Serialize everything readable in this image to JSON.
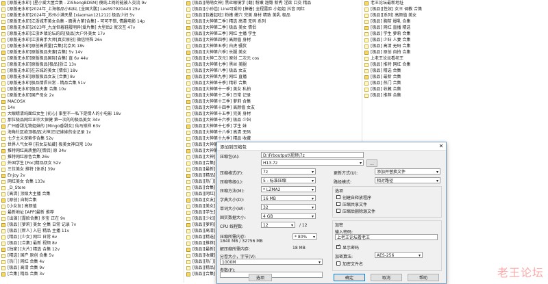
{
  "left_list": [
    "[原版无水印] [星小爱大屋合集 - ZiShengBDSM] 傻纯上网的能被人交流 9v",
    "[原版无水印]2024年_上海极品小纠纠, [全国大鹏] Lee597920443 25v",
    "[原版无水印]2024年_苏州小满天星 [xiaoman121212] 极品少妇 5v",
    "[原版无水印]江浙城市美女合集 - 面勇力第[合集] - 可可不错, 情趣电影 14p",
    "[原版无水印]2023年_九龙但着鞋履明异[爱片集] 大型后2 就次互 47v",
    "[原版无水印]江浙乡镇论坛的的[极品]大户外美女 17v",
    "[原版无水印]江浙高手大师[真实原创] 微信特殊 26v",
    "[原版无水印]原创高质量[合集]北京风 18v",
    "[原版无水印]原版极品夫妻[合集] 5v 14v",
    "[原版无水印]原版极品国际[合集] 直 6v 44v",
    "[原版无水印]原版极品[极品]浙江 13v",
    "[原版无水印]在苏城的美女 [情侣] 18v",
    "[原版无水印]原版极品女友 [合集] 8v",
    "[原版无水印]极品情侣日常 - 精品合集 51v",
    "[原版无水印]极品夫妻 合集 10v",
    "[原版无水印]国产母女 2v",
    "MACOSX",
    "14v",
    "大眼睛清纯面红女生 [初心] 事里不一私下是情人的小电影 18v",
    "那位极品网红正宗大保健 第一次的的极品美女 34v",
    "广州香甜尤物姐妹的 [Mingo香甜女] 仙马锁样 63v",
    "海角社区绝顶极品[大神]日记妹妹的全记录 1v",
    "七夕主义探索作合集 52v",
    "世界人气女神 [前女友私藏] 极美女神日常 10v",
    "推特网红高质量的[情侣] 原 34v",
    "推特网红原色合集 26v",
    "外国学生 [Foc]精品双女 52v",
    "三位美女 推特 [体系] 39v",
    "Enjoy 2v",
    "网红美女 合集 133v",
    "_D_Store",
    "[高清] 顶级大主播 合集",
    "[原创] 自制合集",
    "[小女友] 高颜值",
    "最新地址 [APP]最新 推荐",
    "[出演] [露脸合集] 多宝 正在 9v",
    "[极品] [萝莉] 美女 全集 日常 记录 7v",
    "[极品] [新人] 入驻 精品 主播 11v",
    "[精品] [少女] 网红 日常 6v",
    "[极品] [合集] 最新 视频 8v",
    "[独家] [大片] 精选 合集 12v",
    "[精选] 国产 原创 合集 5v",
    "[热门] 网红 合集 4v",
    "[极品] 高清 合集 9v",
    "[合集] 精品 合集 3v"
  ],
  "mid_list": [
    "[极品][萌萌女神] 黑丝眼镜学 [翻] 粉嫩 翘臀 新秀 淫欲 口交 精品",
    "[极品][小孙芭] Line可爱的 [捧着] 全程露脸 小姐姐 抖音 网红",
    "[极品][包着起吃] 粉嫩 嫩穴 完美 身材 精致 美乳 极品",
    "[极品][大神第二季] 精选 高清 无码 系列",
    "[极品][大神第二季] 极品 美女 情侣",
    "[极品][大神第三季] 网红 主播 学生",
    "[极品][大神第四季] 高颜值 身材",
    "[极品][大神第五季] 白虎 骚货",
    "[极品][大神第六季] 长腿 美女",
    "[极品][大神二次元] 原创 二次元 cos",
    "[极品][大神第七季] 黑丝 美腿",
    "[极品][大神第八季] 极品 女友",
    "[极品][大神第九季] 网红 直播",
    "[极品][大神第十季] 精彩 合集",
    "[极品][大神第十一季] 美女 私拍",
    "[极品][大神第十二季] 日常 记录",
    "[极品][大神第十三季] 萝莉 合集",
    "[极品][大神第十四季] 高颜值 女友",
    "[极品][大神第十五季] 完美 身材",
    "[极品][大神第十六季] 极品 少妇",
    "[极品][大神第十七季] 学生 妹",
    "[极品][大神第十八季] 高清 无码",
    "[极品][大神第十九季] 精品 收藏",
    "[极品][大神第二十季] 网红 主播",
    "[极品][大神第二十一季] 最新 合集",
    "[极品][大神] 合集 推荐",
    "[极品][合集] 推荐 精品",
    "[极品][最新] 合集",
    "[极品][精品] 收藏",
    "[极品][热门] 推荐",
    "[极品][合集] 精选",
    "[极品][网红] 主播",
    "[极品][女友] 日常",
    "[极品][美女] 私拍",
    "[极品][学生] 合集",
    "[极品][少妇] 合集",
    "[极品][萝莉] 合集",
    "[极品][高清] 合集",
    "[极品][精选] 合集",
    "[极品][推荐] 合集",
    "[极品][最新] 推荐",
    "[极品][收藏] 合集",
    "[极品][热门] 合集",
    "[极品][精品] 合集",
    "[极品][合集] 全集"
  ],
  "right_list": [
    "老王论坛最新地址",
    "[极品][性奴] 女王 调教 合集",
    "[极品][系列] 高颜值 美女",
    "[极品] 胸前 爆乳 合集",
    "[极品] 网红 直播 精选",
    "[极品] 学生 萝莉 合集",
    "[极品] 少妇 人妻 合集",
    "[极品] 高清 无码 合集",
    "[极品] 原创 自拍 合集",
    "上老王论坛看老王",
    "[极品] 推特 网红 合集",
    "[极品] 精选 合集",
    "[极品] 最新 合集",
    "[极品] 热门 合集",
    "[极品] 收藏 合集",
    "[极品] 推荐 合集"
  ],
  "dialog": {
    "title": "添加到压缩包",
    "close": "✕",
    "archive_label": "压缩包(A):",
    "archive_path": "D:\\Frboutput\\视频\\7z",
    "archive_name": "H13.7z",
    "browse": "...",
    "format_label": "压缩格式(F):",
    "format": "7z",
    "level_label": "压缩等级(L):",
    "level": "5 - 标准压缩",
    "method_label": "压缩方法(M):",
    "method": "* LZMA2",
    "dict_label": "字典大小(D):",
    "dict": "16 MB",
    "word_label": "单词大小(W):",
    "word": "32",
    "solid_label": "固实数据大小:",
    "solid": "4 GB",
    "threads_label": "CPU 线程数:",
    "threads": "12",
    "threads_of": "/ 12",
    "mem_label": "压缩所需内存:",
    "mem_value": "1840 MB / 32756 MB",
    "mem_pct": "* 80%",
    "decomp_label": "解压缩所需内存:",
    "decomp_value": "18 MB",
    "split_label": "分卷大小，字节(V):",
    "split": "1000M",
    "params_label": "参数(P):",
    "options_btn": "选项",
    "update_label": "更新方式(U):",
    "update": "添加并替换文件",
    "pathmode_label": "路径模式:",
    "pathmode": "相对路径",
    "options_title": "选项",
    "opt1": "创建自释放程序",
    "opt2": "压缩共享文件",
    "opt3": "压缩后删除源文件",
    "encrypt_title": "加密",
    "pwd_label": "输入密码:",
    "pwd_value": "上老王论坛看老王",
    "showpwd": "显示密码",
    "enc_method_label": "加密算法:",
    "enc_method": "AES-256",
    "enc_names": "加密文件名",
    "ok": "确定",
    "cancel": "取消",
    "help": "帮助"
  },
  "watermark": "老王论坛"
}
